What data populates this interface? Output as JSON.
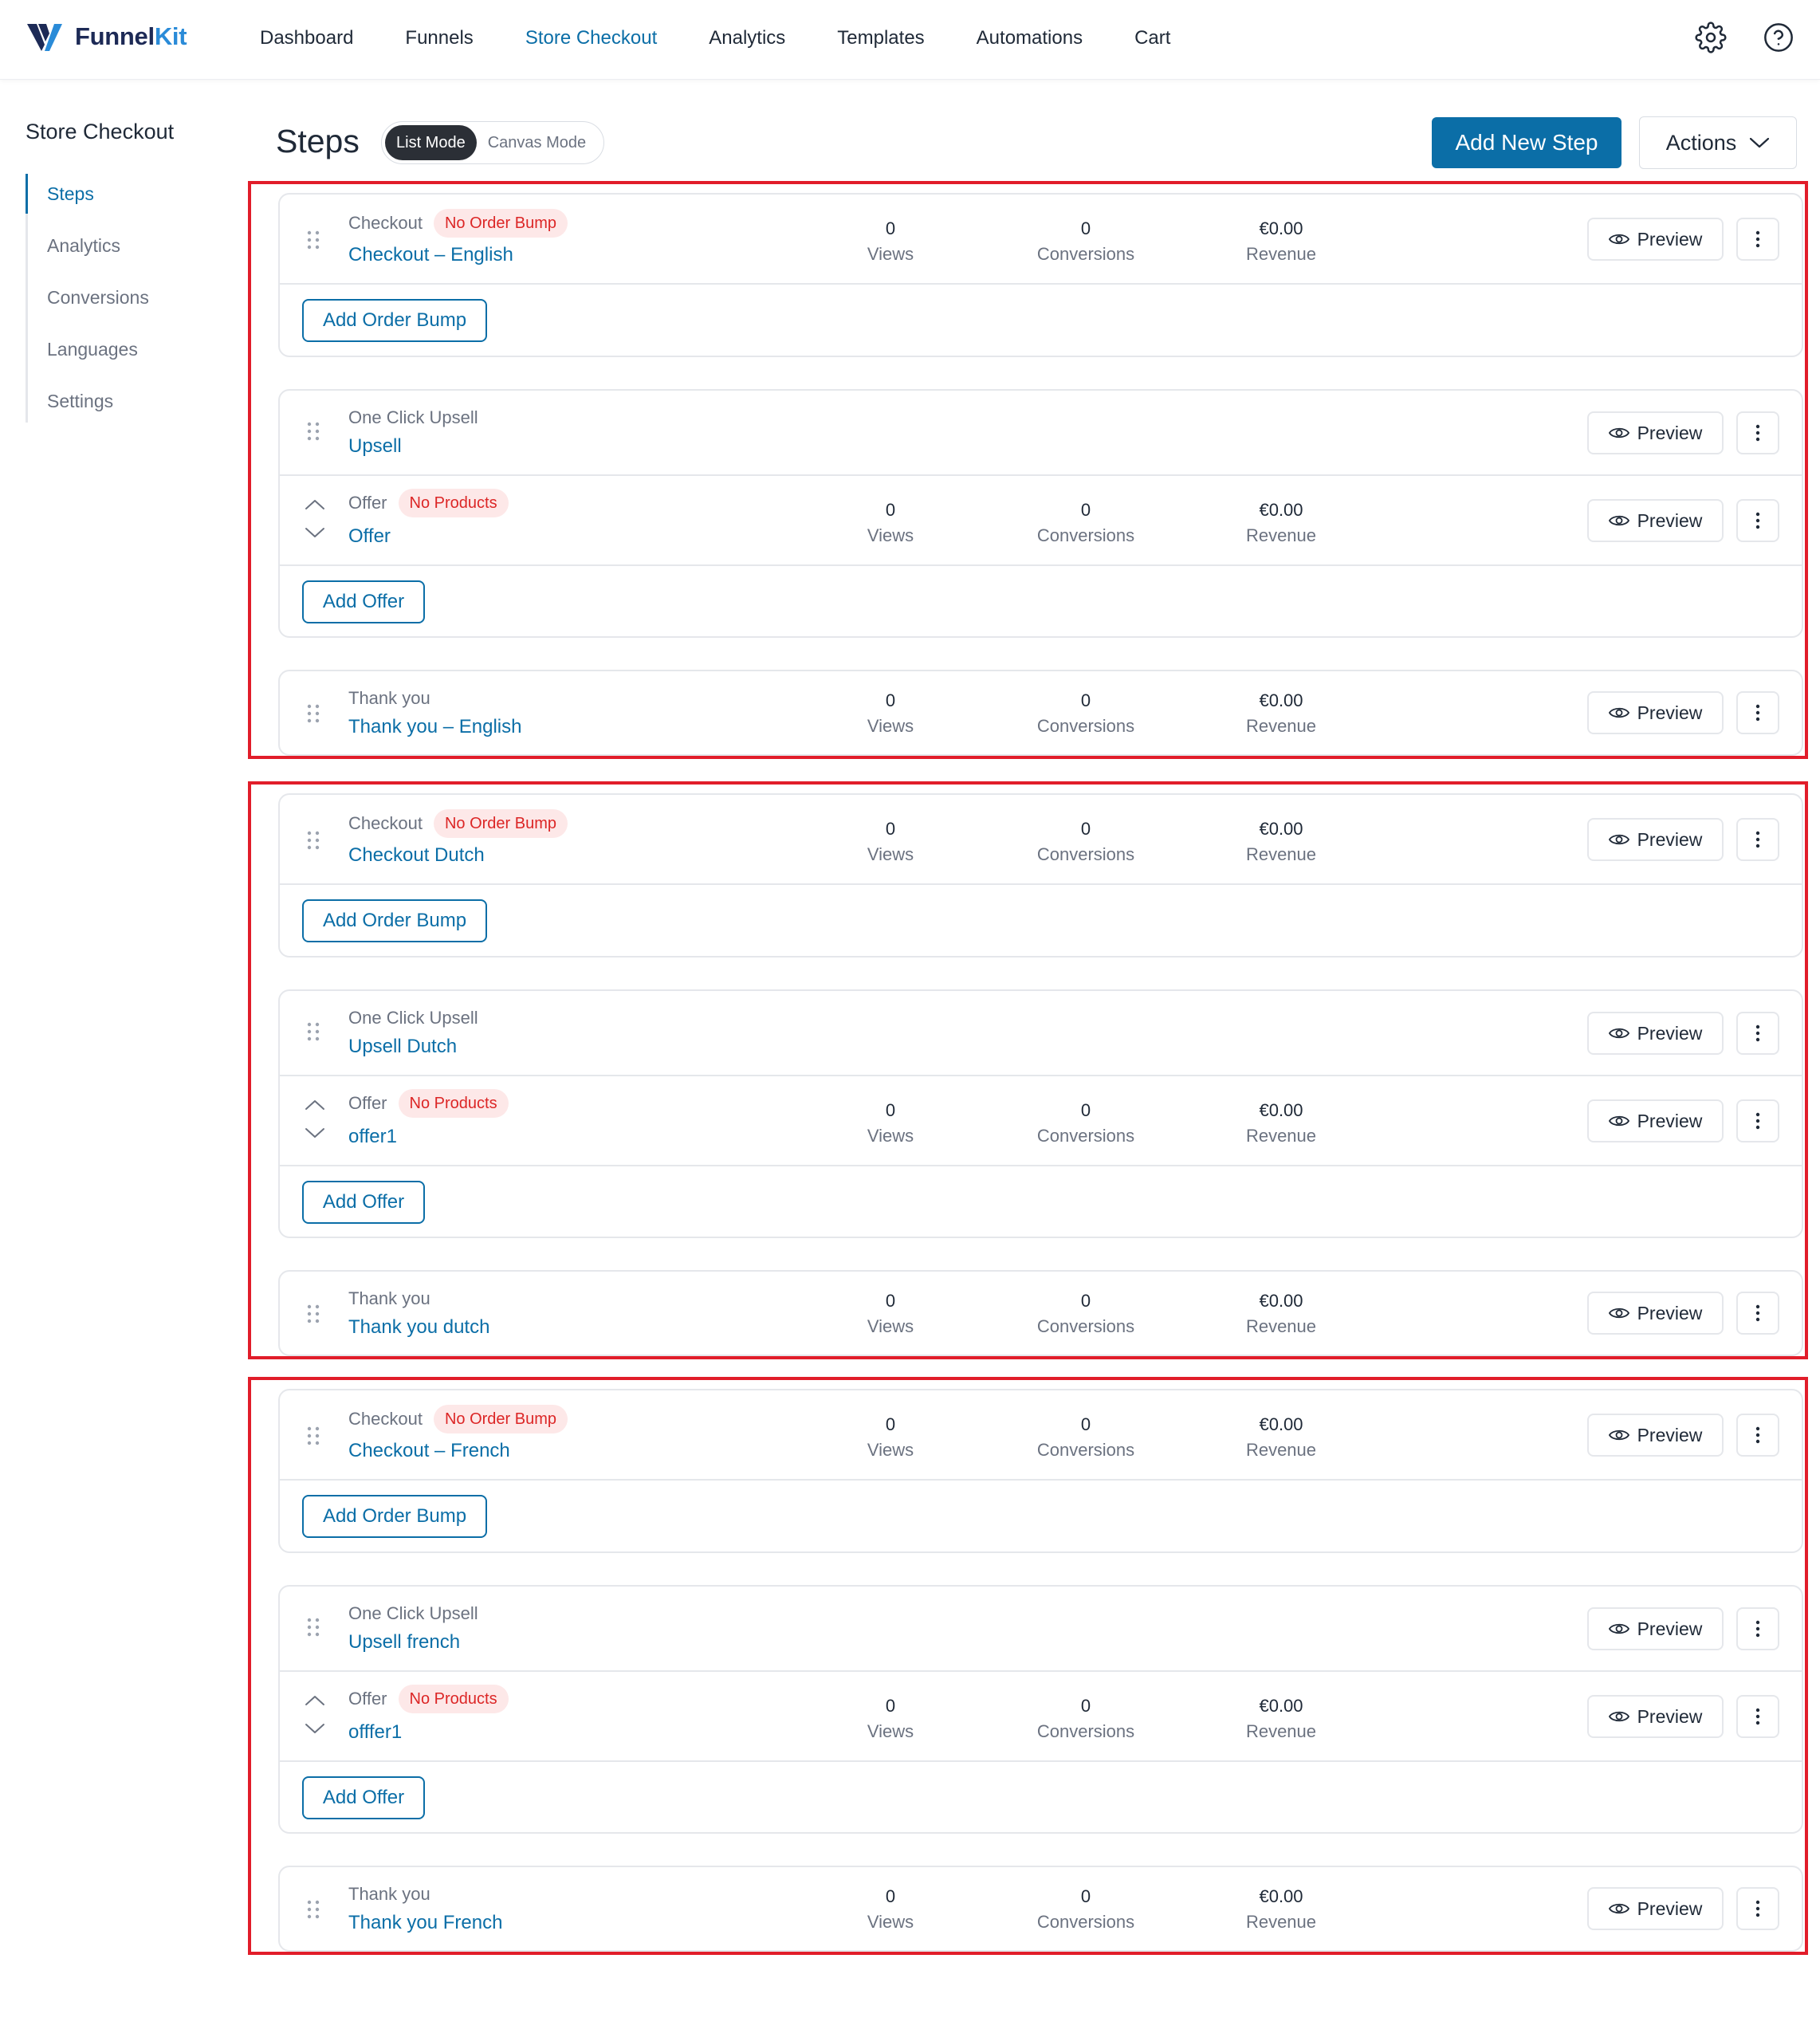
{
  "brand": {
    "part1": "Funnel",
    "part2": "Kit"
  },
  "nav": [
    "Dashboard",
    "Funnels",
    "Store Checkout",
    "Analytics",
    "Templates",
    "Automations",
    "Cart"
  ],
  "sidebar": {
    "title": "Store Checkout",
    "items": [
      "Steps",
      "Analytics",
      "Conversions",
      "Languages",
      "Settings"
    ]
  },
  "header": {
    "title": "Steps",
    "mode_list": "List Mode",
    "mode_canvas": "Canvas Mode",
    "add_new_step": "Add New Step",
    "actions": "Actions"
  },
  "labels": {
    "views": "Views",
    "conversions": "Conversions",
    "revenue": "Revenue",
    "preview": "Preview",
    "add_order_bump": "Add Order Bump",
    "add_offer": "Add Offer",
    "type_checkout": "Checkout",
    "type_upsell": "One Click Upsell",
    "type_offer": "Offer",
    "type_thankyou": "Thank you",
    "badge_no_bump": "No Order Bump",
    "badge_no_products": "No Products"
  },
  "groups": [
    {
      "checkout": {
        "name": "Checkout – English",
        "views": "0",
        "conversions": "0",
        "revenue": "€0.00"
      },
      "upsell": {
        "name": "Upsell"
      },
      "offer": {
        "name": "Offer",
        "views": "0",
        "conversions": "0",
        "revenue": "€0.00"
      },
      "thankyou": {
        "name": "Thank you – English",
        "views": "0",
        "conversions": "0",
        "revenue": "€0.00"
      }
    },
    {
      "checkout": {
        "name": "Checkout Dutch",
        "views": "0",
        "conversions": "0",
        "revenue": "€0.00"
      },
      "upsell": {
        "name": "Upsell Dutch"
      },
      "offer": {
        "name": "offer1",
        "views": "0",
        "conversions": "0",
        "revenue": "€0.00"
      },
      "thankyou": {
        "name": "Thank you dutch",
        "views": "0",
        "conversions": "0",
        "revenue": "€0.00"
      }
    },
    {
      "checkout": {
        "name": "Checkout – French",
        "views": "0",
        "conversions": "0",
        "revenue": "€0.00"
      },
      "upsell": {
        "name": "Upsell french"
      },
      "offer": {
        "name": "offfer1",
        "views": "0",
        "conversions": "0",
        "revenue": "€0.00"
      },
      "thankyou": {
        "name": "Thank you French",
        "views": "0",
        "conversions": "0",
        "revenue": "€0.00"
      }
    }
  ],
  "colors": {
    "accent": "#0b6ea7",
    "highlight_border": "#e11d2a",
    "badge_bg": "#fde8e8",
    "badge_text": "#dc2626",
    "logo_dark": "#1d2a56",
    "logo_light": "#2a8bd8"
  },
  "icons": {
    "logo": "funnelkit-logo-icon",
    "settings": "gear-icon",
    "help": "help-circle-icon",
    "drag": "drag-handle-icon",
    "preview": "eye-icon",
    "more": "more-vertical-icon",
    "actions": "chevron-down-icon",
    "reorder_up": "chevron-up-icon",
    "reorder_down": "chevron-down-icon"
  }
}
